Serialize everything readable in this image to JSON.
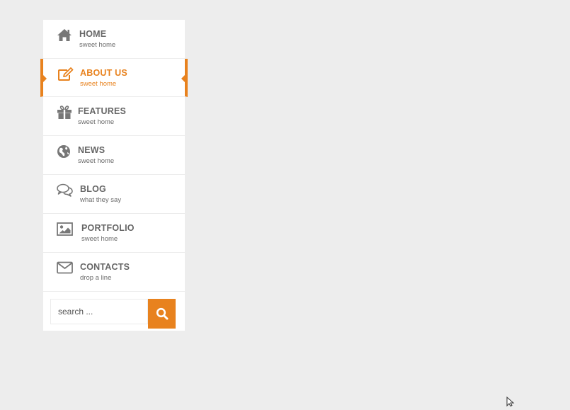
{
  "menu": {
    "items": [
      {
        "title": "HOME",
        "subtitle": "sweet home",
        "icon": "home-icon"
      },
      {
        "title": "ABOUT US",
        "subtitle": "sweet home",
        "icon": "edit-icon",
        "active": true
      },
      {
        "title": "FEATURES",
        "subtitle": "sweet home",
        "icon": "gift-icon"
      },
      {
        "title": "NEWS",
        "subtitle": "sweet home",
        "icon": "globe-icon"
      },
      {
        "title": "BLOG",
        "subtitle": "what they say",
        "icon": "comments-icon"
      },
      {
        "title": "PORTFOLIO",
        "subtitle": "sweet home",
        "icon": "image-icon"
      },
      {
        "title": "CONTACTS",
        "subtitle": "drop a line",
        "icon": "envelope-icon"
      }
    ]
  },
  "search": {
    "placeholder": "search ...",
    "button_icon": "search-icon"
  },
  "colors": {
    "accent": "#e8821e",
    "text": "#666666",
    "background": "#ededed"
  }
}
